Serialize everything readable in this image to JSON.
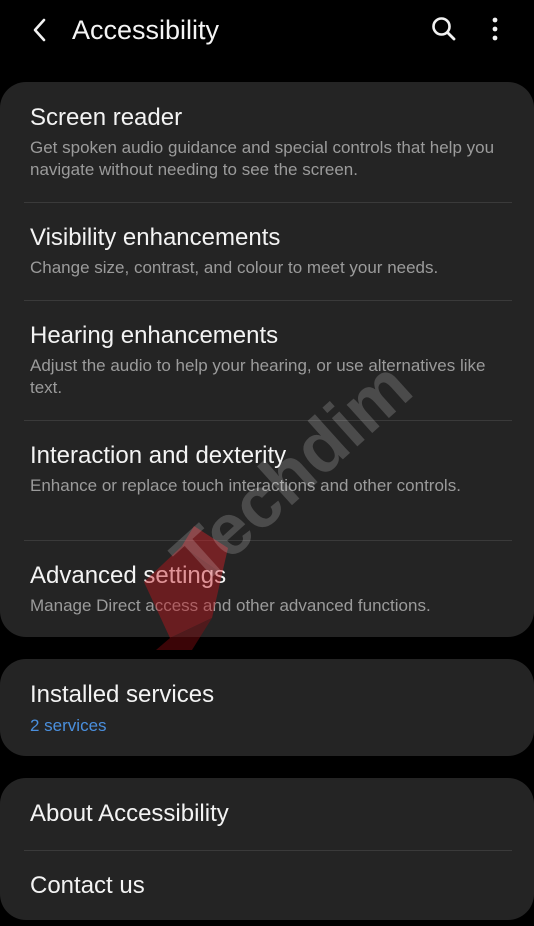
{
  "header": {
    "title": "Accessibility",
    "back_icon": "back-arrow-icon",
    "search_icon": "search-icon",
    "more_icon": "more-vertical-icon"
  },
  "sections": [
    {
      "items": [
        {
          "title": "Screen reader",
          "description": "Get spoken audio guidance and special controls that help you navigate without needing to see the screen."
        },
        {
          "title": "Visibility enhancements",
          "description": "Change size, contrast, and colour to meet your needs."
        },
        {
          "title": "Hearing enhancements",
          "description": "Adjust the audio to help your hearing, or use alternatives like text."
        },
        {
          "title": "Interaction and dexterity",
          "description": "Enhance or replace touch interactions and other controls."
        },
        {
          "title": "Advanced settings",
          "description": "Manage Direct access and other advanced functions."
        }
      ]
    },
    {
      "items": [
        {
          "title": "Installed services",
          "description": "2 services"
        }
      ]
    },
    {
      "items": [
        {
          "title": "About Accessibility"
        },
        {
          "title": "Contact us"
        }
      ]
    }
  ],
  "watermark": {
    "text": "Techdim"
  },
  "colors": {
    "background": "#000000",
    "card": "#242424",
    "primary_text": "#f3f3f3",
    "secondary_text": "#9b9b9b",
    "accent": "#4a8fdd",
    "divider": "#3a3a3a",
    "watermark_logo": "#c8141c"
  }
}
